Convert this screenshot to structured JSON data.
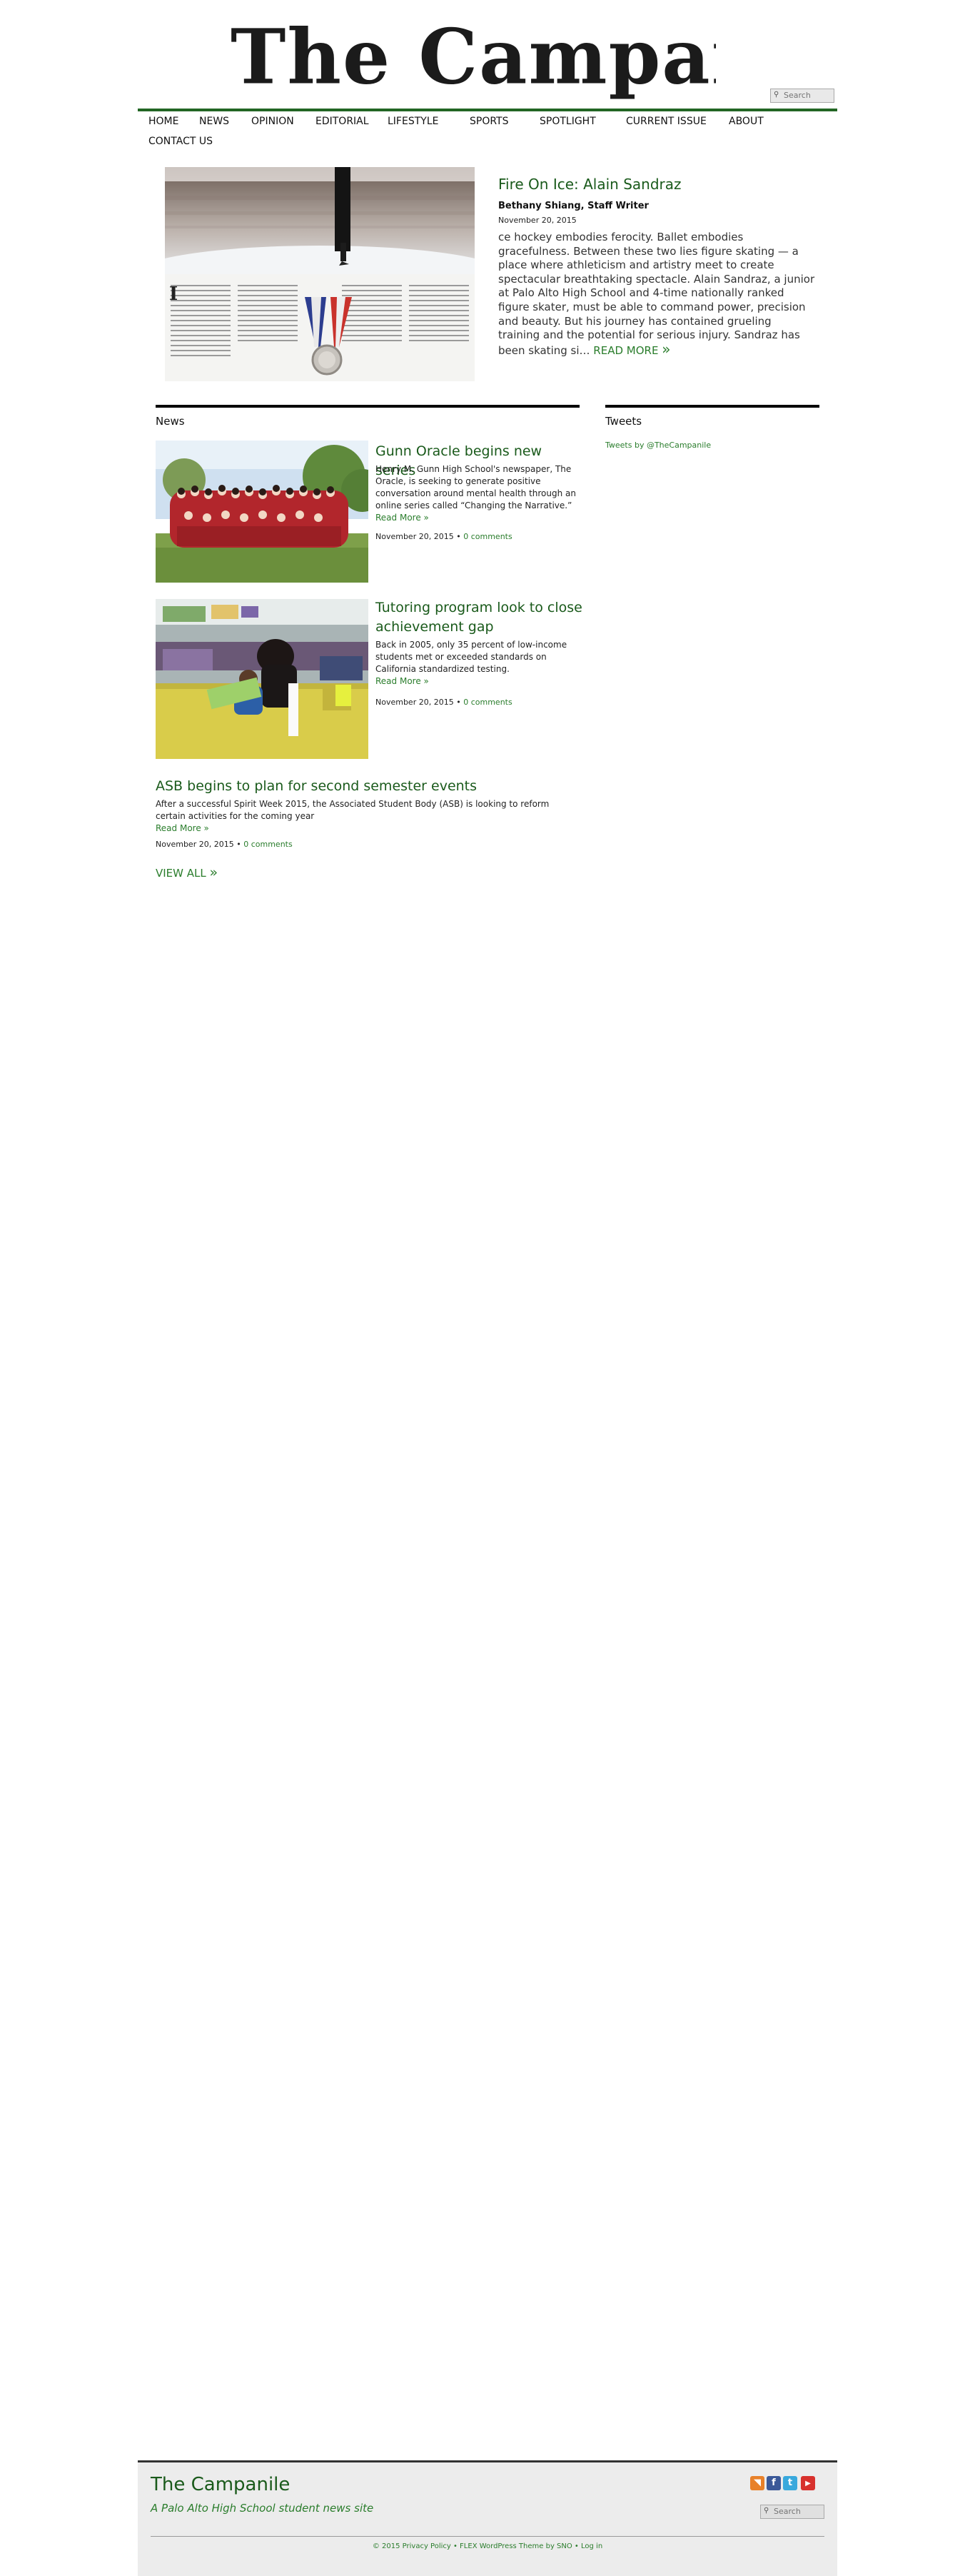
{
  "site": {
    "name": "The Campanile"
  },
  "search": {
    "placeholder": "Search"
  },
  "nav": {
    "items": [
      {
        "label": "HOME"
      },
      {
        "label": "NEWS"
      },
      {
        "label": "OPINION"
      },
      {
        "label": "EDITORIAL"
      },
      {
        "label": "LIFESTYLE"
      },
      {
        "label": "SPORTS"
      },
      {
        "label": "SPOTLIGHT"
      },
      {
        "label": "CURRENT ISSUE"
      },
      {
        "label": "ABOUT"
      },
      {
        "label": "CONTACT US"
      }
    ]
  },
  "featured": {
    "title": "Fire On Ice: Alain Sandraz",
    "byline": "Bethany Shiang, Staff Writer",
    "date": "November 20, 2015",
    "excerpt": "ce hockey embodies ferocity. Ballet embodies gracefulness. Between these two lies figure skating — a place where athleticism and artistry meet to create spectacular breathtaking spectacle. Alain Sandraz, a junior at Palo Alto High School and 4-time nationally ranked figure skater, must be able to command power, precision and beauty. But his journey has contained grueling training and the potential for serious injury. Sandraz has been skating si…",
    "read_more": "READ MORE",
    "read_more_arrow": "»"
  },
  "news": {
    "heading": "News",
    "stories": [
      {
        "title": "Gunn Oracle begins new series",
        "excerpt": "Henry M. Gunn High School's newspaper, The Oracle, is seeking to generate positive conversation around mental health through an online series called “Changing the Narrative.”",
        "read_more": "Read More »",
        "date": "November 20, 2015",
        "comments": "0 comments"
      },
      {
        "title": "Tutoring program look to close achievement gap",
        "excerpt": "Back in 2005, only 35 percent of low-income students met or exceeded standards on California standardized testing.",
        "read_more": "Read More »",
        "date": "November 20, 2015",
        "comments": "0 comments"
      },
      {
        "title": "ASB begins to plan for second semester events",
        "excerpt": "After a successful Spirit Week 2015, the Associated Student Body (ASB) is looking to reform certain activities for the coming year",
        "read_more": "Read More »",
        "date": "November 20, 2015",
        "comments": "0 comments"
      }
    ],
    "meta_separator": "•",
    "view_all": "VIEW ALL",
    "view_all_arrow": "»"
  },
  "tweets": {
    "heading": "Tweets",
    "link": "Tweets by @TheCampanile"
  },
  "footer": {
    "title": "The Campanile",
    "tagline": "A Palo Alto High School student news site",
    "copyright": "© 2015 Privacy Policy • FLEX WordPress Theme by SNO • Log in",
    "social": [
      {
        "icon": "rss-icon",
        "glyph": "◥",
        "color": "#e8812a"
      },
      {
        "icon": "facebook-icon",
        "glyph": "f",
        "color": "#3b5998"
      },
      {
        "icon": "twitter-icon",
        "glyph": "t",
        "color": "#39a9dd"
      },
      {
        "icon": "youtube-icon",
        "glyph": "▶",
        "color": "#d8312d"
      }
    ]
  },
  "colors": {
    "accent_green": "#226624",
    "link_green": "#2a7d2c",
    "title_green": "#1a5a1b",
    "footer_bg": "#ececec"
  }
}
